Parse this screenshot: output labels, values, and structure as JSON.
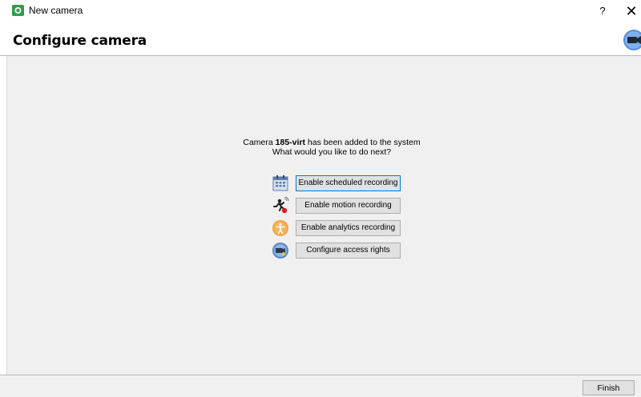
{
  "window": {
    "title": "New camera",
    "help_label": "?",
    "close_label": "✕"
  },
  "header": {
    "title": "Configure camera"
  },
  "message": {
    "line1_prefix": "Camera ",
    "camera_name": "185-virt",
    "line1_suffix": " has been added to the system",
    "line2": "What would you like to do next?"
  },
  "actions": [
    {
      "label": "Enable scheduled recording",
      "icon": "calendar-icon"
    },
    {
      "label": "Enable motion recording",
      "icon": "motion-runner-icon"
    },
    {
      "label": "Enable analytics recording",
      "icon": "analytics-person-icon"
    },
    {
      "label": "Configure access rights",
      "icon": "access-rights-icon"
    }
  ],
  "footer": {
    "finish_label": "Finish"
  },
  "colors": {
    "content_bg": "#f0f0f0",
    "button_bg": "#e1e1e1",
    "focus_border": "#0078d7",
    "app_icon_green": "#2ea44f"
  }
}
